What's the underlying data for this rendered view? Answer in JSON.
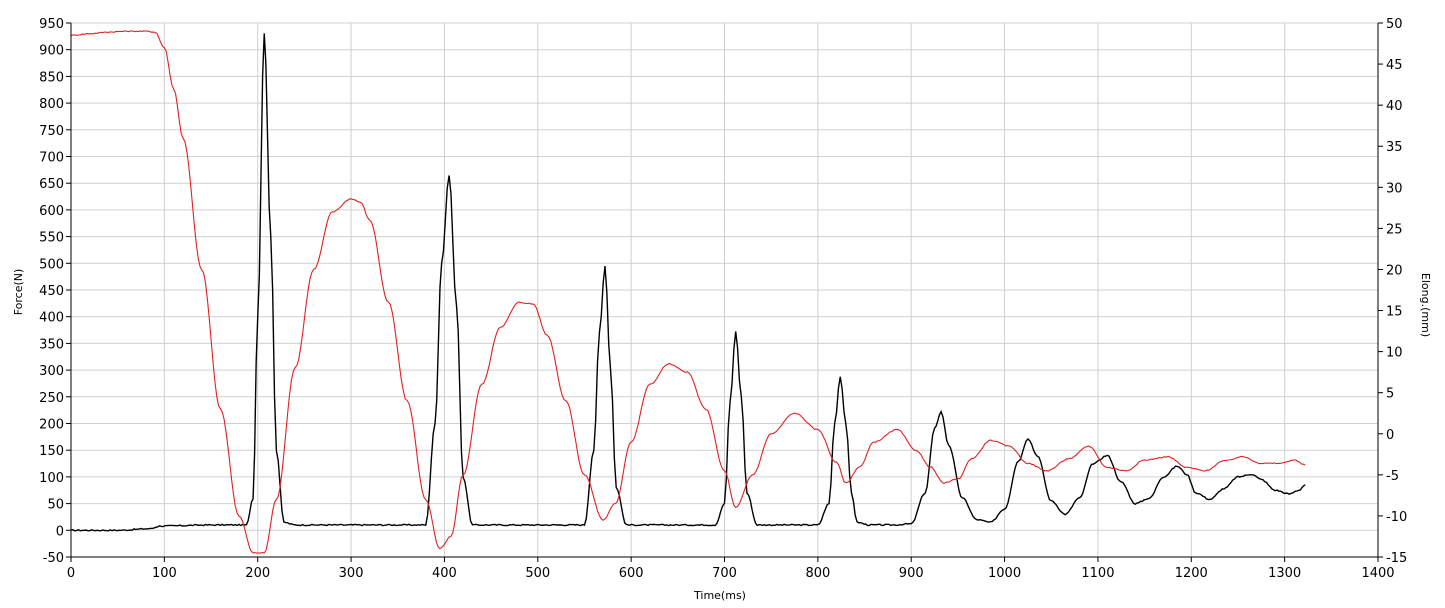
{
  "chart_data": {
    "type": "line",
    "xlabel": "Time(ms)",
    "ylabel_left": "Force(N)",
    "ylabel_right": "Elong.(mm)",
    "xlim": [
      0,
      1400
    ],
    "ylim_left": [
      -50,
      950
    ],
    "ylim_right": [
      -15,
      50
    ],
    "x_ticks": [
      0,
      100,
      200,
      300,
      400,
      500,
      600,
      700,
      800,
      900,
      1000,
      1100,
      1200,
      1300,
      1400
    ],
    "y_left_ticks": [
      -50,
      0,
      50,
      100,
      150,
      200,
      250,
      300,
      350,
      400,
      450,
      500,
      550,
      600,
      650,
      700,
      750,
      800,
      850,
      900,
      950
    ],
    "y_right_ticks": [
      -15,
      -10,
      -5,
      0,
      5,
      10,
      15,
      20,
      25,
      30,
      35,
      40,
      45,
      50
    ],
    "grid": true,
    "series": [
      {
        "axis": "left",
        "color": "#000000",
        "x": [
          0,
          50,
          85,
          95,
          150,
          188,
          195,
          200,
          207,
          214,
          220,
          228,
          240,
          300,
          380,
          390,
          397,
          405,
          413,
          420,
          430,
          450,
          500,
          550,
          560,
          566,
          572,
          578,
          584,
          595,
          610,
          650,
          690,
          700,
          706,
          712,
          718,
          724,
          735,
          760,
          800,
          812,
          818,
          824,
          830,
          836,
          842,
          855,
          880,
          900,
          915,
          925,
          932,
          940,
          955,
          970,
          985,
          1000,
          1015,
          1025,
          1035,
          1050,
          1065,
          1080,
          1095,
          1110,
          1125,
          1140,
          1155,
          1170,
          1185,
          1195,
          1205,
          1220,
          1235,
          1250,
          1265,
          1275,
          1290,
          1305,
          1315,
          1322
        ],
        "y": [
          0,
          0,
          3,
          8,
          10,
          10,
          60,
          400,
          930,
          550,
          150,
          15,
          10,
          10,
          10,
          200,
          500,
          665,
          420,
          100,
          10,
          10,
          10,
          10,
          150,
          370,
          495,
          300,
          80,
          10,
          10,
          10,
          10,
          50,
          240,
          372,
          250,
          70,
          10,
          10,
          10,
          50,
          200,
          288,
          200,
          70,
          15,
          10,
          10,
          12,
          70,
          190,
          222,
          160,
          60,
          20,
          15,
          40,
          130,
          172,
          140,
          55,
          30,
          60,
          125,
          140,
          90,
          50,
          60,
          100,
          120,
          105,
          70,
          58,
          78,
          100,
          105,
          95,
          75,
          68,
          75,
          85
        ]
      },
      {
        "axis": "right",
        "color": "#e02020",
        "x": [
          0,
          20,
          40,
          60,
          80,
          90,
          100,
          110,
          120,
          140,
          160,
          180,
          195,
          207,
          220,
          240,
          260,
          280,
          300,
          310,
          320,
          340,
          360,
          380,
          395,
          407,
          420,
          440,
          460,
          480,
          495,
          510,
          530,
          550,
          570,
          583,
          600,
          620,
          640,
          660,
          680,
          700,
          712,
          730,
          750,
          775,
          800,
          820,
          830,
          845,
          860,
          885,
          905,
          920,
          935,
          950,
          965,
          985,
          1005,
          1025,
          1045,
          1070,
          1090,
          1110,
          1130,
          1150,
          1175,
          1195,
          1215,
          1235,
          1255,
          1275,
          1295,
          1310,
          1322
        ],
        "y": [
          48.5,
          48.7,
          48.9,
          49,
          49,
          48.9,
          47,
          42,
          36,
          20,
          3,
          -10,
          -14.5,
          -14.5,
          -8,
          8,
          20,
          27,
          28.6,
          28.2,
          26,
          16,
          4,
          -8,
          -14,
          -12.5,
          -5,
          6,
          13,
          16,
          15.8,
          12,
          4,
          -5,
          -10.5,
          -8.5,
          -1,
          6,
          8.5,
          7.5,
          3,
          -4.5,
          -9,
          -5,
          0,
          2.5,
          0.5,
          -3.5,
          -6,
          -4,
          -1,
          0.5,
          -2,
          -4,
          -6,
          -5.5,
          -3,
          -0.8,
          -1.5,
          -3.6,
          -4.5,
          -3,
          -1.5,
          -4.1,
          -4.5,
          -3.2,
          -2.8,
          -4.1,
          -4.5,
          -3.3,
          -2.8,
          -3.6,
          -3.6,
          -3.2,
          -3.8
        ]
      }
    ]
  }
}
